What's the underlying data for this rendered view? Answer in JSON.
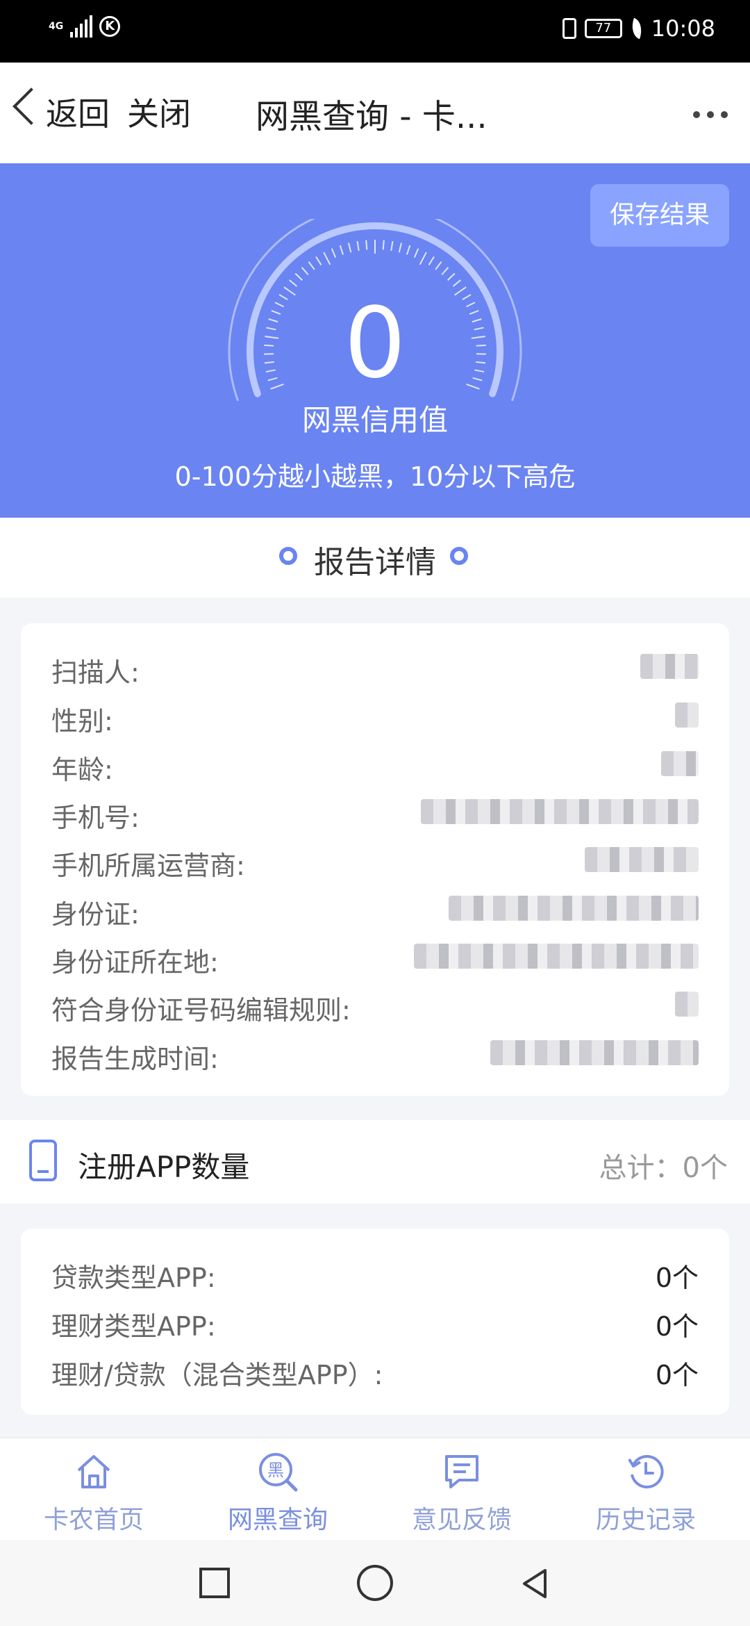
{
  "status_bar": {
    "network": "4G",
    "carrier_badge": "K",
    "battery": "77",
    "time": "10:08"
  },
  "header": {
    "back_label": "返回",
    "close_label": "关闭",
    "title": "网黑查询 - 卡...",
    "more_icon": "more-dots-icon"
  },
  "hero": {
    "save_button": "保存结果",
    "score": "0",
    "score_fraction": 0,
    "score_label": "网黑信用值",
    "hint": "0-100分越小越黑，10分以下高危"
  },
  "report": {
    "title": "报告详情",
    "rows": [
      {
        "label": "扫描人:"
      },
      {
        "label": "性别:"
      },
      {
        "label": "年龄:"
      },
      {
        "label": "手机号:"
      },
      {
        "label": "手机所属运营商:"
      },
      {
        "label": "身份证:"
      },
      {
        "label": "身份证所在地:"
      },
      {
        "label": "符合身份证号码编辑规则:"
      },
      {
        "label": "报告生成时间:"
      }
    ]
  },
  "apps": {
    "title": "注册APP数量",
    "total": "总计：0个",
    "rows": [
      {
        "label": "贷款类型APP:",
        "value": "0个"
      },
      {
        "label": "理财类型APP:",
        "value": "0个"
      },
      {
        "label": "理财/贷款（混合类型APP）:",
        "value": "0个"
      }
    ]
  },
  "bottom_nav": {
    "items": [
      {
        "label": "卡农首页",
        "icon": "home-icon"
      },
      {
        "label": "网黑查询",
        "icon": "blacklist-search-icon",
        "icon_glyph": "黑"
      },
      {
        "label": "意见反馈",
        "icon": "feedback-icon"
      },
      {
        "label": "历史记录",
        "icon": "history-icon"
      }
    ]
  },
  "colors": {
    "accent": "#6a84f2",
    "nav_icon": "#7a8fe0"
  }
}
